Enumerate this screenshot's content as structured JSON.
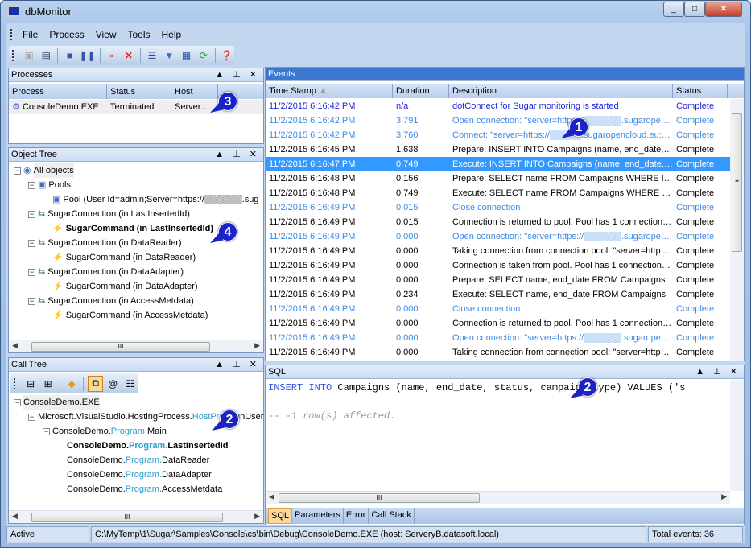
{
  "window": {
    "title": "dbMonitor",
    "controls": [
      "_",
      "□",
      "✕"
    ]
  },
  "menu": [
    "File",
    "Process",
    "View",
    "Tools",
    "Help"
  ],
  "toolbar": [
    "save",
    "save-as",
    "stop",
    "pause",
    "delete-selected",
    "delete-all",
    "events",
    "filter",
    "columns",
    "refresh",
    "help"
  ],
  "processes": {
    "title": "Processes",
    "columns": [
      "Process",
      "Status",
      "Host"
    ],
    "rows": [
      {
        "process": "ConsoleDemo.EXE",
        "status": "Terminated",
        "host": "Server…"
      }
    ]
  },
  "object_tree": {
    "title": "Object Tree",
    "items": [
      {
        "label": "All objects",
        "level": 0,
        "bold": false
      },
      {
        "label": "Pools",
        "level": 1,
        "bold": false
      },
      {
        "label": "Pool (User Id=admin;Server=https://▒▒▒▒▒▒.sug",
        "level": 2,
        "bold": false
      },
      {
        "label": "SugarConnection (in LastInsertedId)",
        "level": 1,
        "bold": false
      },
      {
        "label": "SugarCommand (in LastInsertedId)",
        "level": 2,
        "bold": true
      },
      {
        "label": "SugarConnection (in DataReader)",
        "level": 1,
        "bold": false
      },
      {
        "label": "SugarCommand (in DataReader)",
        "level": 2,
        "bold": false
      },
      {
        "label": "SugarConnection (in DataAdapter)",
        "level": 1,
        "bold": false
      },
      {
        "label": "SugarCommand (in DataAdapter)",
        "level": 2,
        "bold": false
      },
      {
        "label": "SugarConnection (in AccessMetdata)",
        "level": 1,
        "bold": false
      },
      {
        "label": "SugarCommand (in AccessMetdata)",
        "level": 2,
        "bold": false
      }
    ]
  },
  "call_tree": {
    "title": "Call Tree",
    "items": [
      {
        "parts": [
          "ConsoleDemo.EXE"
        ],
        "level": 0,
        "bold": false
      },
      {
        "parts": [
          "Microsoft.VisualStudio.HostingProcess.",
          "HostProc",
          "RunUser"
        ],
        "level": 1,
        "bold": false
      },
      {
        "parts": [
          "ConsoleDemo.",
          "Program.",
          "Main"
        ],
        "level": 2,
        "bold": false
      },
      {
        "parts": [
          "ConsoleDemo.",
          "Program.",
          "LastInsertedId"
        ],
        "level": 3,
        "bold": true
      },
      {
        "parts": [
          "ConsoleDemo.",
          "Program.",
          "DataReader"
        ],
        "level": 3,
        "bold": false
      },
      {
        "parts": [
          "ConsoleDemo.",
          "Program.",
          "DataAdapter"
        ],
        "level": 3,
        "bold": false
      },
      {
        "parts": [
          "ConsoleDemo.",
          "Program.",
          "AccessMetdata"
        ],
        "level": 3,
        "bold": false
      }
    ]
  },
  "events": {
    "title": "Events",
    "columns": [
      "Time Stamp",
      "Duration",
      "Description",
      "Status"
    ],
    "selected_index": 4,
    "rows": [
      {
        "time": "11/2/2015 6:16:42 PM",
        "duration": "n/a",
        "description": "dotConnect for Sugar monitoring is started",
        "status": "Complete",
        "color": "#1f1fe0"
      },
      {
        "time": "11/2/2015 6:16:42 PM",
        "duration": "3.791",
        "description": "Open connection: \"server=https://▒▒▒▒▒▒.sugaropen…",
        "status": "Complete",
        "color": "#3c8ae6"
      },
      {
        "time": "11/2/2015 6:16:42 PM",
        "duration": "3.760",
        "description": "Connect: \"server=https://▒▒▒▒▒.sugaropencloud.eu;…",
        "status": "Complete",
        "color": "#3c8ae6"
      },
      {
        "time": "11/2/2015 6:16:45 PM",
        "duration": "1.638",
        "description": "Prepare: INSERT INTO Campaigns (name, end_date, s…",
        "status": "Complete",
        "color": "#000000"
      },
      {
        "time": "11/2/2015 6:16:47 PM",
        "duration": "0.749",
        "description": "Execute: INSERT INTO Campaigns (name, end_date, s…",
        "status": "Complete",
        "color": "#000000"
      },
      {
        "time": "11/2/2015 6:16:48 PM",
        "duration": "0.156",
        "description": "Prepare: SELECT name FROM Campaigns WHERE Id = :id",
        "status": "Complete",
        "color": "#000000"
      },
      {
        "time": "11/2/2015 6:16:48 PM",
        "duration": "0.749",
        "description": "Execute: SELECT name FROM Campaigns WHERE Id = :id",
        "status": "Complete",
        "color": "#000000"
      },
      {
        "time": "11/2/2015 6:16:49 PM",
        "duration": "0.015",
        "description": "Close connection",
        "status": "Complete",
        "color": "#3c8ae6"
      },
      {
        "time": "11/2/2015 6:16:49 PM",
        "duration": "0.015",
        "description": "Connection is returned to pool. Pool has 1 connection(s).",
        "status": "Complete",
        "color": "#000000"
      },
      {
        "time": "11/2/2015 6:16:49 PM",
        "duration": "0.000",
        "description": "Open connection: \"server=https://▒▒▒▒▒▒.sugaropen…",
        "status": "Complete",
        "color": "#3c8ae6"
      },
      {
        "time": "11/2/2015 6:16:49 PM",
        "duration": "0.000",
        "description": "Taking connection from connection pool: \"server=https…",
        "status": "Complete",
        "color": "#000000"
      },
      {
        "time": "11/2/2015 6:16:49 PM",
        "duration": "0.000",
        "description": "Connection is taken from pool. Pool has 1 connection(s).",
        "status": "Complete",
        "color": "#000000"
      },
      {
        "time": "11/2/2015 6:16:49 PM",
        "duration": "0.000",
        "description": "Prepare: SELECT name, end_date FROM Campaigns",
        "status": "Complete",
        "color": "#000000"
      },
      {
        "time": "11/2/2015 6:16:49 PM",
        "duration": "0.234",
        "description": "Execute: SELECT name, end_date FROM Campaigns",
        "status": "Complete",
        "color": "#000000"
      },
      {
        "time": "11/2/2015 6:16:49 PM",
        "duration": "0.000",
        "description": "Close connection",
        "status": "Complete",
        "color": "#3c8ae6"
      },
      {
        "time": "11/2/2015 6:16:49 PM",
        "duration": "0.000",
        "description": "Connection is returned to pool. Pool has 1 connection(s).",
        "status": "Complete",
        "color": "#000000"
      },
      {
        "time": "11/2/2015 6:16:49 PM",
        "duration": "0.000",
        "description": "Open connection: \"server=https://▒▒▒▒▒▒.sugaropen…",
        "status": "Complete",
        "color": "#3c8ae6"
      },
      {
        "time": "11/2/2015 6:16:49 PM",
        "duration": "0.000",
        "description": "Taking connection from connection pool: \"server=https…",
        "status": "Complete",
        "color": "#000000"
      }
    ]
  },
  "sql": {
    "title": "SQL",
    "kw1": "INSERT",
    "kw2": "INTO",
    "rest": " Campaigns (name, end_date, status, campaign_type) VALUES ('s",
    "comment": "-- -1 row(s) affected.",
    "tabs": [
      "SQL",
      "Parameters",
      "Error",
      "Call Stack"
    ],
    "active_tab": "SQL"
  },
  "status": {
    "state": "Active",
    "path": "C:\\MyTemp\\1\\Sugar\\Samples\\Console\\cs\\bin\\Debug\\ConsoleDemo.EXE (host: ServeryB.datasoft.local)",
    "total": "Total events: 36"
  },
  "callouts": [
    "1",
    "2",
    "3",
    "4",
    "2"
  ]
}
